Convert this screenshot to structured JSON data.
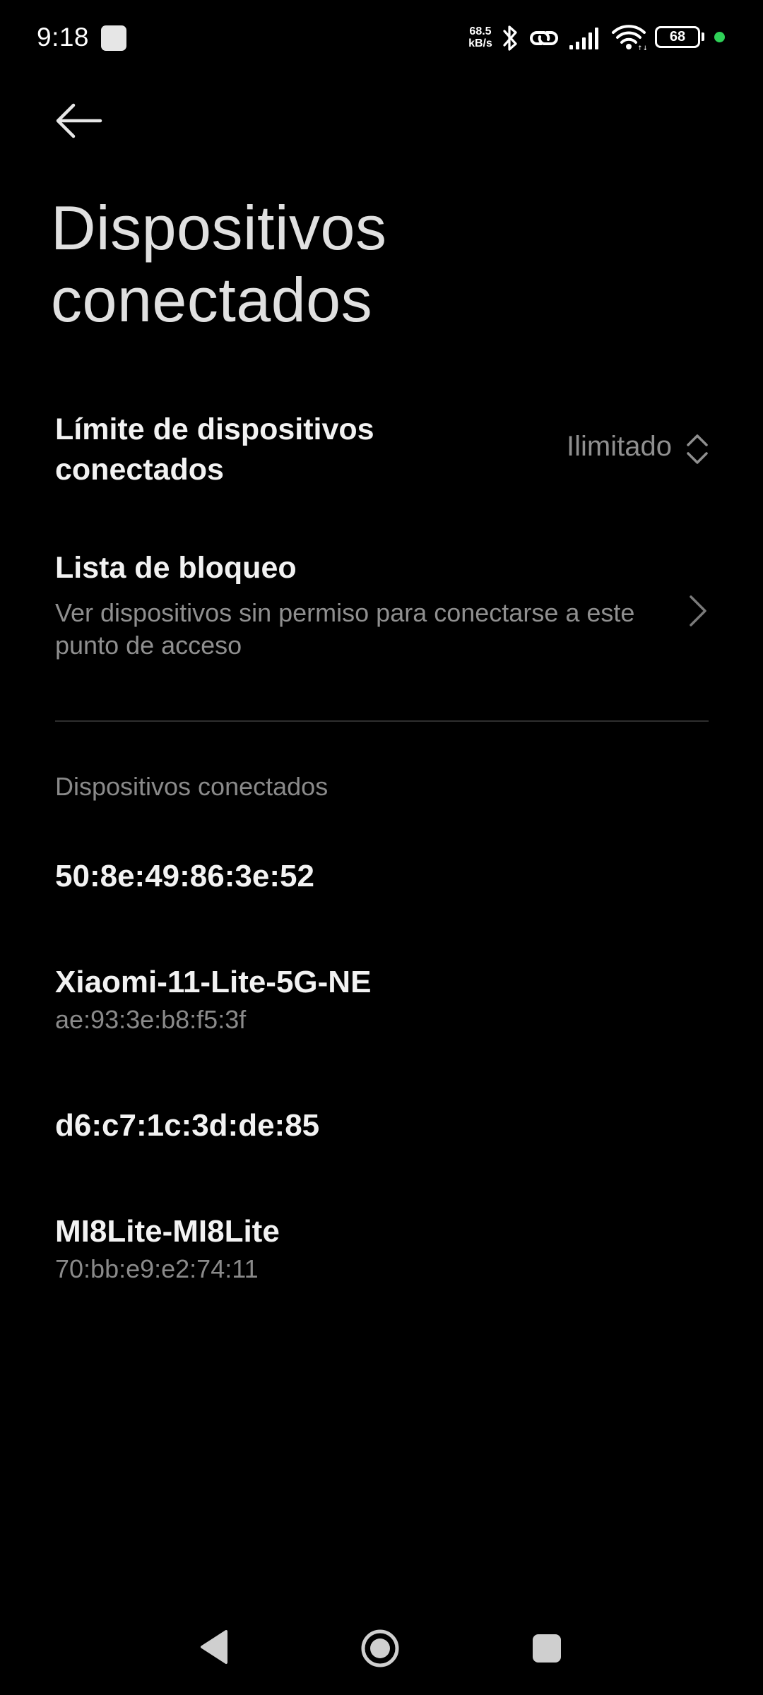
{
  "status_bar": {
    "time": "9:18",
    "net_speed_value": "68.5",
    "net_speed_unit": "kB/s",
    "battery_level": "68",
    "icons": [
      "notification-square-icon",
      "bluetooth-icon",
      "hotspot-link-icon",
      "cellular-signal-icon",
      "wifi-icon",
      "battery-icon",
      "privacy-dot-icon"
    ]
  },
  "header": {
    "title_line1": "Dispositivos",
    "title_line2": "conectados",
    "back_icon": "back-arrow-icon"
  },
  "limit_setting": {
    "label_line1": "Límite de dispositivos",
    "label_line2": "conectados",
    "value": "Ilimitado",
    "icon": "up-down-chevron-icon"
  },
  "block_list": {
    "title": "Lista de bloqueo",
    "subtitle": "Ver dispositivos sin permiso para conectarse a este punto de acceso",
    "icon": "chevron-right-icon"
  },
  "connected_section": {
    "header": "Dispositivos conectados",
    "devices": [
      {
        "name": "50:8e:49:86:3e:52",
        "mac": ""
      },
      {
        "name": "Xiaomi-11-Lite-5G-NE",
        "mac": "ae:93:3e:b8:f5:3f"
      },
      {
        "name": "d6:c7:1c:3d:de:85",
        "mac": ""
      },
      {
        "name": "MI8Lite-MI8Lite",
        "mac": "70:bb:e9:e2:74:11"
      }
    ]
  },
  "nav_bar": {
    "icons": [
      "nav-back-icon",
      "nav-home-icon",
      "nav-recents-icon"
    ]
  },
  "colors": {
    "background": "#000000",
    "primary_text": "#f2f2f2",
    "secondary_text": "#8f8f8f",
    "accent_dot": "#2fd158"
  }
}
